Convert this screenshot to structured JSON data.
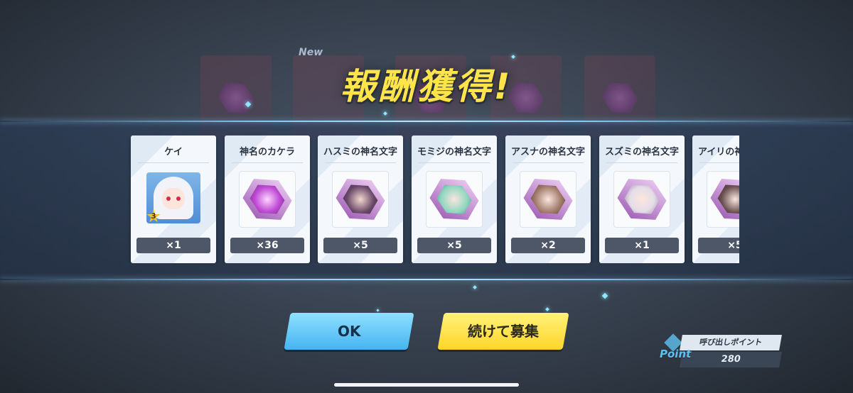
{
  "title": "報酬獲得!",
  "background": {
    "new_label": "New"
  },
  "rewards": [
    {
      "name": "ケイ",
      "count": "×1",
      "kind": "student",
      "star": "3",
      "hex_color": "#4f8ed6"
    },
    {
      "name": "神名のカケラ",
      "count": "×36",
      "kind": "fragment",
      "hex_color": "#c04cd6"
    },
    {
      "name": "ハスミの神名文字",
      "count": "×5",
      "kind": "character",
      "hex_color": "#6a4a6a"
    },
    {
      "name": "モミジの神名文字",
      "count": "×5",
      "kind": "character",
      "hex_color": "#8fd6c0"
    },
    {
      "name": "アスナの神名文字",
      "count": "×2",
      "kind": "character",
      "hex_color": "#a07a6a"
    },
    {
      "name": "スズミの神名文字",
      "count": "×1",
      "kind": "character",
      "hex_color": "#e4dde8"
    },
    {
      "name": "アイリの神名文字",
      "count": "×5",
      "kind": "character",
      "hex_color": "#6a5050"
    }
  ],
  "buttons": {
    "ok": "OK",
    "continue": "続けて募集"
  },
  "points": {
    "label": "呼び出しポイント",
    "value": "280",
    "icon_text": "Point"
  },
  "colors": {
    "title": "#ffe54a",
    "ok_button": "#45b4f0",
    "continue_button": "#ffd52a",
    "count_bar": "#4d5768"
  }
}
